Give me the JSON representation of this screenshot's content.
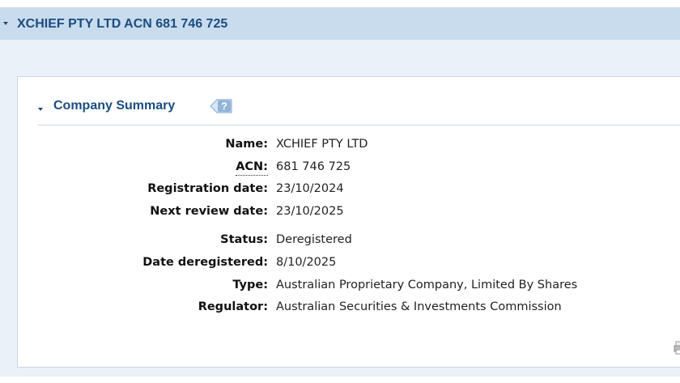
{
  "company_panel": {
    "title": "XCHIEF PTY LTD ACN 681 746 725"
  },
  "summary": {
    "title": "Company Summary",
    "help_label": "?",
    "fields": [
      {
        "label": "Name:",
        "value": "XCHIEF PTY LTD"
      },
      {
        "label": "ACN:",
        "value": "681 746 725"
      },
      {
        "label": "Registration date:",
        "value": "23/10/2024"
      },
      {
        "label": "Next review date:",
        "value": "23/10/2025"
      },
      {
        "label": "Status:",
        "value": "Deregistered"
      },
      {
        "label": "Date deregistered:",
        "value": "8/10/2025"
      },
      {
        "label": "Type:",
        "value": "Australian Proprietary Company, Limited By Shares"
      },
      {
        "label": "Regulator:",
        "value": "Australian Securities & Investments Commission"
      }
    ]
  },
  "colors": {
    "panel_header": "#c9dcee",
    "panel_body": "#eaf1f8",
    "title_text": "#1b4d80",
    "help_icon": "#8fb4d6"
  },
  "icons": {
    "collapse_outer": "chevron-down-icon",
    "collapse_inner": "chevron-down-icon",
    "help": "help-icon",
    "print": "print-icon"
  }
}
